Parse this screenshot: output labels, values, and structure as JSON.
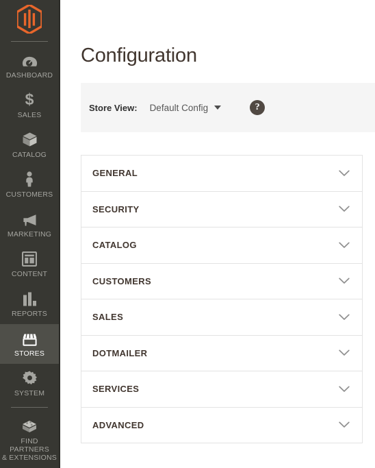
{
  "sidebar": {
    "logo": {
      "icon": "magento-logo-icon",
      "color": "#e8662b"
    },
    "items": [
      {
        "label": "DASHBOARD",
        "icon": "dashboard-gauge-icon",
        "active": false
      },
      {
        "label": "SALES",
        "icon": "dollar-sign-icon",
        "active": false
      },
      {
        "label": "CATALOG",
        "icon": "box-icon",
        "active": false
      },
      {
        "label": "CUSTOMERS",
        "icon": "person-icon",
        "active": false
      },
      {
        "label": "MARKETING",
        "icon": "megaphone-icon",
        "active": false
      },
      {
        "label": "CONTENT",
        "icon": "layout-page-icon",
        "active": false
      },
      {
        "label": "REPORTS",
        "icon": "bar-chart-icon",
        "active": false
      },
      {
        "label": "STORES",
        "icon": "storefront-icon",
        "active": true
      },
      {
        "label": "SYSTEM",
        "icon": "gear-icon",
        "active": false
      },
      {
        "label": "FIND PARTNERS\n& EXTENSIONS",
        "icon": "extension-block-icon",
        "active": false
      }
    ]
  },
  "header": {
    "title": "Configuration"
  },
  "store_view": {
    "label": "Store View:",
    "value": "Default Config",
    "caret_icon": "caret-down-icon",
    "help_icon": "question-mark-icon",
    "help_glyph": "?"
  },
  "sections": [
    {
      "title": "GENERAL",
      "chevron_icon": "chevron-down-icon",
      "expanded": false
    },
    {
      "title": "SECURITY",
      "chevron_icon": "chevron-down-icon",
      "expanded": false
    },
    {
      "title": "CATALOG",
      "chevron_icon": "chevron-down-icon",
      "expanded": false
    },
    {
      "title": "CUSTOMERS",
      "chevron_icon": "chevron-down-icon",
      "expanded": false
    },
    {
      "title": "SALES",
      "chevron_icon": "chevron-down-icon",
      "expanded": false
    },
    {
      "title": "DOTMAILER",
      "chevron_icon": "chevron-down-icon",
      "expanded": false
    },
    {
      "title": "SERVICES",
      "chevron_icon": "chevron-down-icon",
      "expanded": false
    },
    {
      "title": "ADVANCED",
      "chevron_icon": "chevron-down-icon",
      "expanded": false
    }
  ],
  "colors": {
    "sidebar_bg": "#373732",
    "sidebar_active_bg": "#4f4f49",
    "accent_orange": "#e8662b",
    "panel_bg": "#f5f5f5",
    "text_dark": "#41362f"
  }
}
